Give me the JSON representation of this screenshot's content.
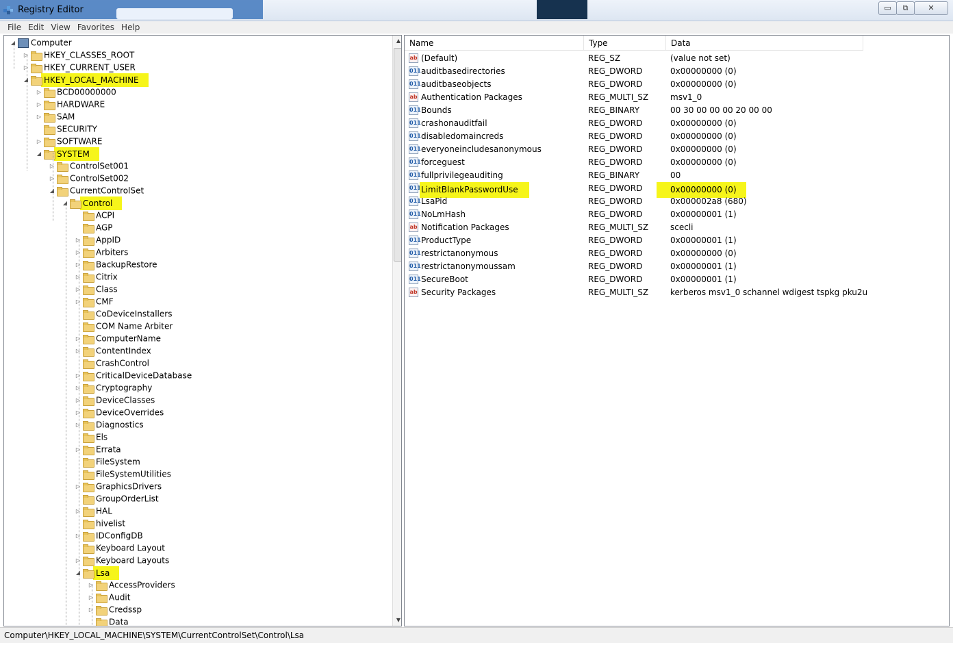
{
  "window": {
    "title": "Registry Editor",
    "minimize": "▭",
    "restore": "⧉",
    "close": "✕"
  },
  "menu": [
    "File",
    "Edit",
    "View",
    "Favorites",
    "Help"
  ],
  "tree": {
    "root": "Computer",
    "hives": [
      "HKEY_CLASSES_ROOT",
      "HKEY_CURRENT_USER",
      "HKEY_LOCAL_MACHINE"
    ],
    "hklm_children": [
      "BCD00000000",
      "HARDWARE",
      "SAM",
      "SECURITY",
      "SOFTWARE",
      "SYSTEM"
    ],
    "system_children": [
      "ControlSet001",
      "ControlSet002",
      "CurrentControlSet"
    ],
    "ccs_children": [
      "Control"
    ],
    "control_children": [
      "ACPI",
      "AGP",
      "AppID",
      "Arbiters",
      "BackupRestore",
      "Citrix",
      "Class",
      "CMF",
      "CoDeviceInstallers",
      "COM Name Arbiter",
      "ComputerName",
      "ContentIndex",
      "CrashControl",
      "CriticalDeviceDatabase",
      "Cryptography",
      "DeviceClasses",
      "DeviceOverrides",
      "Diagnostics",
      "Els",
      "Errata",
      "FileSystem",
      "FileSystemUtilities",
      "GraphicsDrivers",
      "GroupOrderList",
      "HAL",
      "hivelist",
      "IDConfigDB",
      "Keyboard Layout",
      "Keyboard Layouts",
      "Lsa"
    ],
    "lsa_children": [
      "AccessProviders",
      "Audit",
      "Credssp",
      "Data"
    ],
    "highlighted": [
      "HKEY_LOCAL_MACHINE",
      "SYSTEM",
      "Control",
      "Lsa"
    ]
  },
  "list": {
    "columns": [
      "Name",
      "Type",
      "Data"
    ],
    "rows": [
      {
        "icon": "ab",
        "name": "(Default)",
        "type": "REG_SZ",
        "data": "(value not set)"
      },
      {
        "icon": "bin",
        "name": "auditbasedirectories",
        "type": "REG_DWORD",
        "data": "0x00000000 (0)"
      },
      {
        "icon": "bin",
        "name": "auditbaseobjects",
        "type": "REG_DWORD",
        "data": "0x00000000 (0)"
      },
      {
        "icon": "ab",
        "name": "Authentication Packages",
        "type": "REG_MULTI_SZ",
        "data": "msv1_0"
      },
      {
        "icon": "bin",
        "name": "Bounds",
        "type": "REG_BINARY",
        "data": "00 30 00 00 00 20 00 00"
      },
      {
        "icon": "bin",
        "name": "crashonauditfail",
        "type": "REG_DWORD",
        "data": "0x00000000 (0)"
      },
      {
        "icon": "bin",
        "name": "disabledomaincreds",
        "type": "REG_DWORD",
        "data": "0x00000000 (0)"
      },
      {
        "icon": "bin",
        "name": "everyoneincludesanonymous",
        "type": "REG_DWORD",
        "data": "0x00000000 (0)"
      },
      {
        "icon": "bin",
        "name": "forceguest",
        "type": "REG_DWORD",
        "data": "0x00000000 (0)"
      },
      {
        "icon": "bin",
        "name": "fullprivilegeauditing",
        "type": "REG_BINARY",
        "data": "00"
      },
      {
        "icon": "bin",
        "name": "LimitBlankPasswordUse",
        "type": "REG_DWORD",
        "data": "0x00000000 (0)",
        "highlight": true
      },
      {
        "icon": "bin",
        "name": "LsaPid",
        "type": "REG_DWORD",
        "data": "0x000002a8 (680)"
      },
      {
        "icon": "bin",
        "name": "NoLmHash",
        "type": "REG_DWORD",
        "data": "0x00000001 (1)"
      },
      {
        "icon": "ab",
        "name": "Notification Packages",
        "type": "REG_MULTI_SZ",
        "data": "scecli"
      },
      {
        "icon": "bin",
        "name": "ProductType",
        "type": "REG_DWORD",
        "data": "0x00000001 (1)"
      },
      {
        "icon": "bin",
        "name": "restrictanonymous",
        "type": "REG_DWORD",
        "data": "0x00000000 (0)"
      },
      {
        "icon": "bin",
        "name": "restrictanonymoussam",
        "type": "REG_DWORD",
        "data": "0x00000001 (1)"
      },
      {
        "icon": "bin",
        "name": "SecureBoot",
        "type": "REG_DWORD",
        "data": "0x00000001 (1)"
      },
      {
        "icon": "ab",
        "name": "Security Packages",
        "type": "REG_MULTI_SZ",
        "data": "kerberos msv1_0 schannel wdigest tspkg pku2u"
      }
    ]
  },
  "status": {
    "path": "Computer\\HKEY_LOCAL_MACHINE\\SYSTEM\\CurrentControlSet\\Control\\Lsa"
  },
  "colors": {
    "highlight": "#f6f51a",
    "folder": "#f2d27a"
  }
}
